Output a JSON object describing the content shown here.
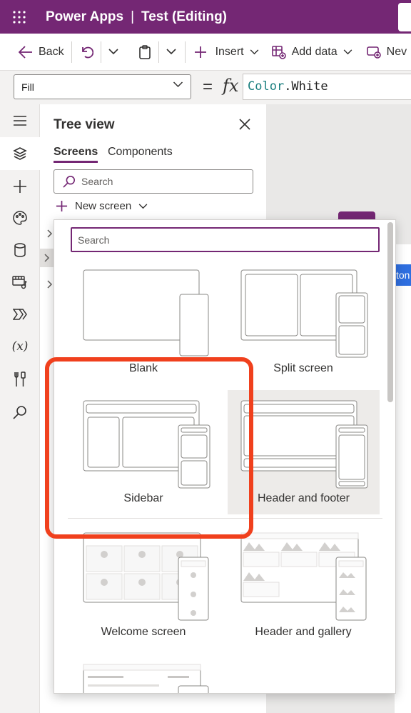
{
  "titlebar": {
    "app_name": "Power Apps",
    "separator": "|",
    "document": "Test (Editing)",
    "waffle_icon": "waffle-icon",
    "bg_color": "#742774"
  },
  "command_bar": {
    "back_label": "Back",
    "insert_label": "Insert",
    "add_data_label": "Add data",
    "new_label": "Nev",
    "icons": [
      "back-arrow-icon",
      "undo-icon",
      "chevron-down-icon",
      "clipboard-icon",
      "plus-icon",
      "add-data-icon",
      "new-screen-icon"
    ]
  },
  "formula_bar": {
    "property": "Fill",
    "equals": "=",
    "fx": "fx",
    "formula_keyword": "Color",
    "formula_rest": ".White"
  },
  "rail": {
    "items": [
      "hamburger-icon",
      "layers-icon",
      "plus-icon",
      "palette-icon",
      "database-icon",
      "media-icon",
      "power-automate-icon",
      "variables-icon",
      "tools-icon",
      "search-icon"
    ],
    "variables_label": "(x)"
  },
  "tree_view": {
    "title": "Tree view",
    "tabs": [
      "Screens",
      "Components"
    ],
    "active_tab": "Screens",
    "search_placeholder": "Search",
    "new_screen_label": "New screen"
  },
  "canvas": {
    "button_fragment": "ton"
  },
  "new_screen_panel": {
    "search_placeholder": "Search",
    "layouts": [
      {
        "label": "Blank"
      },
      {
        "label": "Split screen"
      },
      {
        "label": "Sidebar",
        "highlighted": true
      },
      {
        "label": "Header and footer",
        "hovered": true
      },
      {
        "label": "Welcome screen"
      },
      {
        "label": "Header and gallery"
      }
    ],
    "highlight_color": "#f0401d"
  }
}
